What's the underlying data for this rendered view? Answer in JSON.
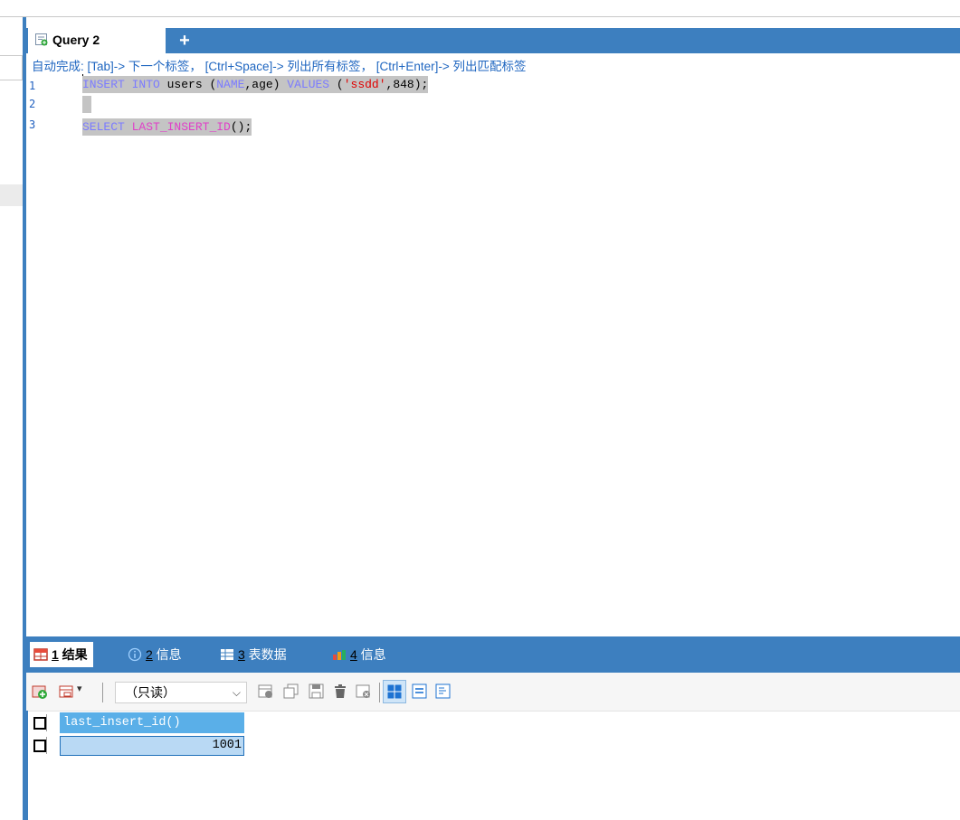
{
  "editor": {
    "tab_label": "Query 2",
    "add_tab_label": "+",
    "hint": "自动完成: [Tab]-> 下一个标签， [Ctrl+Space]-> 列出所有标签， [Ctrl+Enter]-> 列出匹配标签",
    "gutter": [
      "1",
      "2",
      "3"
    ],
    "line1": {
      "insert_into": "INSERT INTO",
      "table": " users ",
      "paren_open": "(",
      "col1": "NAME",
      "comma_age": ",age)",
      "values": " VALUES ",
      "paren2": "(",
      "str": "'ssdd'",
      "rest": ",848);"
    },
    "line3": {
      "select": "SELECT",
      "space": " ",
      "func": "LAST_INSERT_ID",
      "rest": "();"
    }
  },
  "results": {
    "tabs": [
      {
        "num": "1",
        "label": " 结果"
      },
      {
        "num": "2",
        "label": " 信息"
      },
      {
        "num": "3",
        "label": " 表数据"
      },
      {
        "num": "4",
        "label": " 信息"
      }
    ],
    "readonly_option": "（只读）",
    "column_header": "last_insert_id()",
    "cell_value": "1001"
  },
  "colors": {
    "accent": "#3d7fbf",
    "keyword": "#7b7bff",
    "function": "#e040c8",
    "string": "#e00000",
    "grid_header": "#5aafe8",
    "grid_cell": "#b9d9f4"
  }
}
